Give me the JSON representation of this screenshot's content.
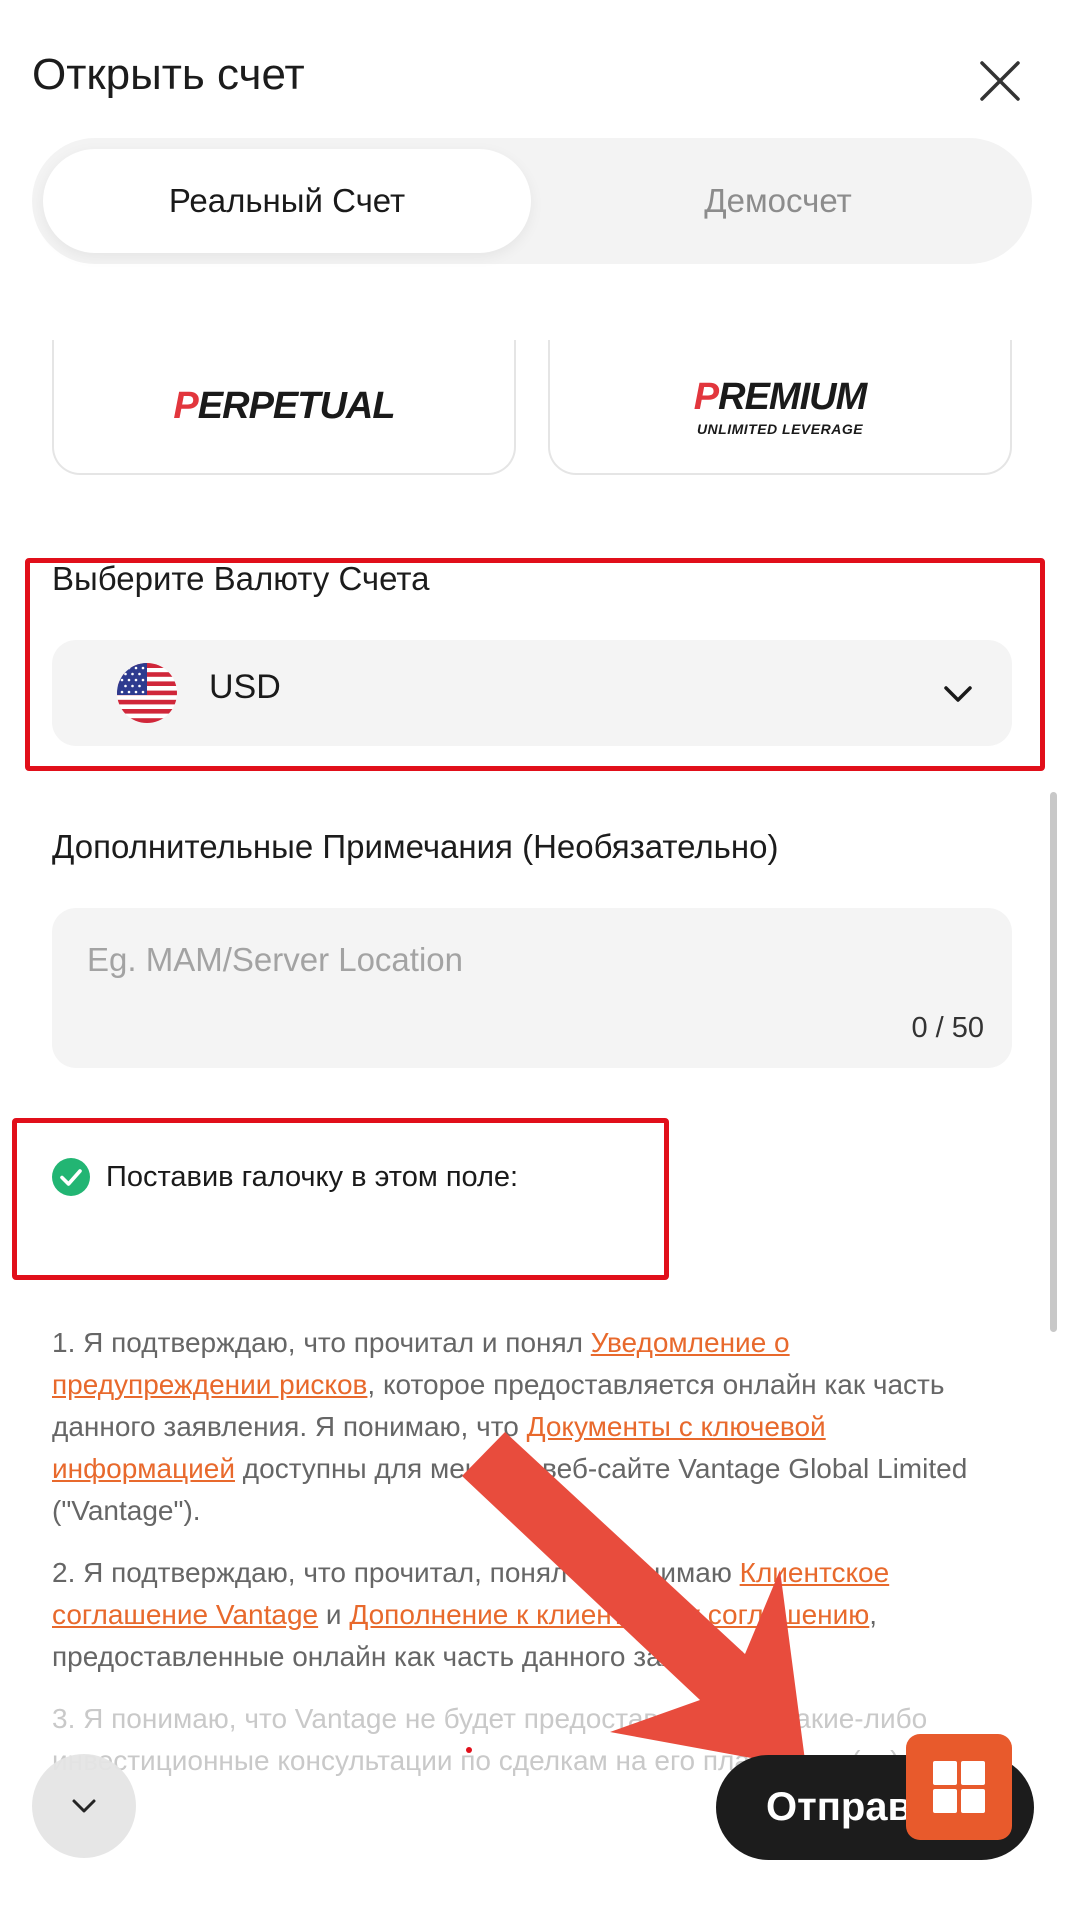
{
  "header": {
    "title": "Открыть счет"
  },
  "tabs": [
    {
      "label": "Реальный Счет",
      "active": true
    },
    {
      "label": "Демосчет",
      "active": false
    }
  ],
  "account_types": [
    {
      "first_letter": "P",
      "rest": "ERPETUAL",
      "subtitle": ""
    },
    {
      "first_letter": "P",
      "rest": "REMIUM",
      "subtitle": "UNLIMITED LEVERAGE"
    }
  ],
  "currency": {
    "label": "Выберите Валюту Счета",
    "value": "USD",
    "icon": "us-flag-icon"
  },
  "notes": {
    "label": "Дополнительные Примечания (Необязательно)",
    "placeholder": "Eg. MAM/Server Location",
    "counter": "0 / 50"
  },
  "consent": {
    "label": "Поставив галочку в этом поле:",
    "checked": true
  },
  "terms": {
    "p1": {
      "t1": "1. Я подтверждаю, что прочитал и понял ",
      "link1": "Уведомление о предупреждении рисков",
      "t2": ", которое предоставляется онлайн как часть данного заявления. Я понимаю, что ",
      "link2": "Документы с ключевой информацией",
      "t3": " доступны для меня на веб-сайте Vantage Global Limited (\"Vantage\")."
    },
    "p2": {
      "t1": "2. Я подтверждаю, что прочитал, понял и принимаю ",
      "link1": "Клиентское соглашение Vantage",
      "t2": " и ",
      "link2": "Дополнение к клиентскому соглашению",
      "t3": ", предоставленные онлайн как часть данного заявления."
    },
    "p3": "3. Я понимаю, что Vantage не будет предоставлять мне какие-либо инвестиционные консультации по сделкам на его платформе(ах)."
  },
  "submit_label": "Отправить",
  "colors": {
    "accent": "#e8692c",
    "highlight_box": "#e10f1a",
    "arrow": "#e84c3d",
    "check": "#22b573"
  }
}
